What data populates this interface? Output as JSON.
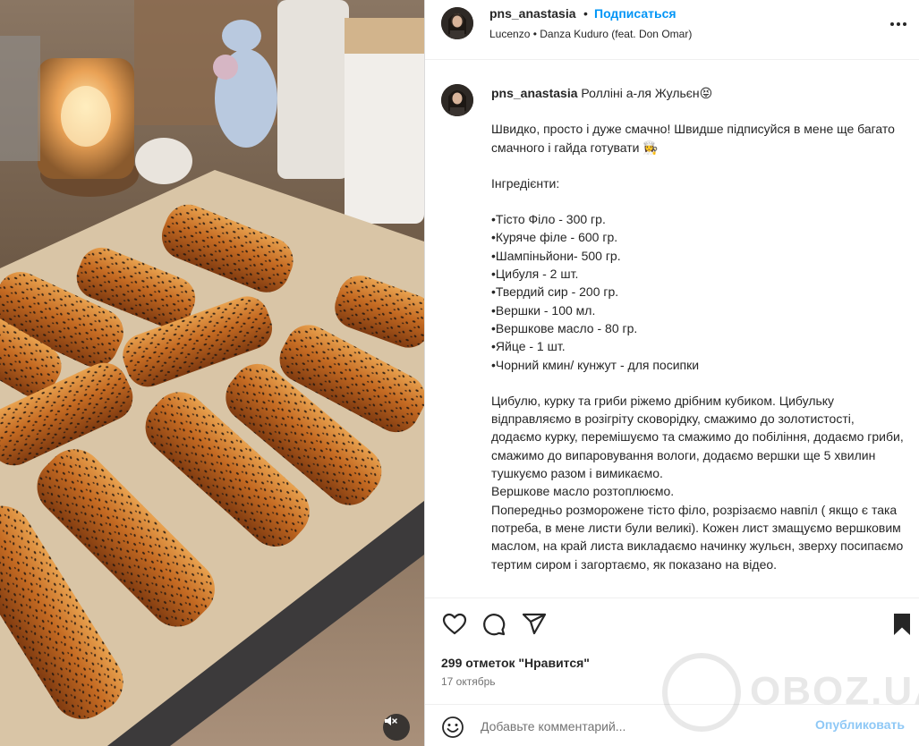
{
  "header": {
    "username": "pns_anastasia",
    "separator": "•",
    "follow_label": "Подписаться",
    "audio": "Lucenzo • Danza Kuduro (feat. Don Omar)"
  },
  "caption": {
    "username": "pns_anastasia",
    "title": "Ролліні а-ля Жульєн😝",
    "paragraphs": [
      "Швидко, просто і дуже смачно! Швидше підписуйся в мене ще багато смачного і гайда готувати 👩‍🍳",
      "Інгредієнти:",
      "•Тісто Філо - 300 гр.\n•Куряче філе - 600 гр.\n•Шампіньйони- 500 гр.\n•Цибуля - 2 шт.\n•Твердий сир - 200 гр.\n•Вершки - 100 мл.\n•Вершкове масло - 80 гр.\n•Яйце - 1 шт.\n•Чорний кмин/ кунжут - для посипки",
      "Цибулю, курку та гриби ріжемо дрібним кубиком. Цибульку відправляємо в розігріту сковорідку, смажимо до золотистості, додаємо курку, перемішуємо та смажимо до побіління, додаємо гриби, смажимо до випаровування вологи, додаємо вершки ще 5 хвилин тушкуємо разом і вимикаємо.\nВершкове масло розтоплюємо.\nПопередньо розморожене тісто філо, розрізаємо навпіл ( якщо є така потреба, в мене листи були великі). Кожен лист змащуємо вершковим маслом, на край листа викладаємо начинку жульєн, зверху посипаємо тертим сиром і загортаємо, як показано на відео."
    ]
  },
  "actions": {
    "likes": "299 отметок \"Нравится\"",
    "date": "17 октябрь",
    "comment_placeholder": "Добавьте комментарий...",
    "post_label": "Опубликовать"
  },
  "watermark": {
    "text": "OBOZ.UA"
  },
  "icons": {
    "like": "heart-icon",
    "comment": "comment-icon",
    "share": "share-icon",
    "save": "bookmark-icon",
    "more": "more-icon",
    "emoji": "emoji-icon",
    "mute": "muted-speaker-icon"
  },
  "colors": {
    "link_blue": "#0095f6",
    "post_button_disabled": "#8ec8f6",
    "secondary_text": "#737373",
    "border": "#dbdbdb"
  }
}
